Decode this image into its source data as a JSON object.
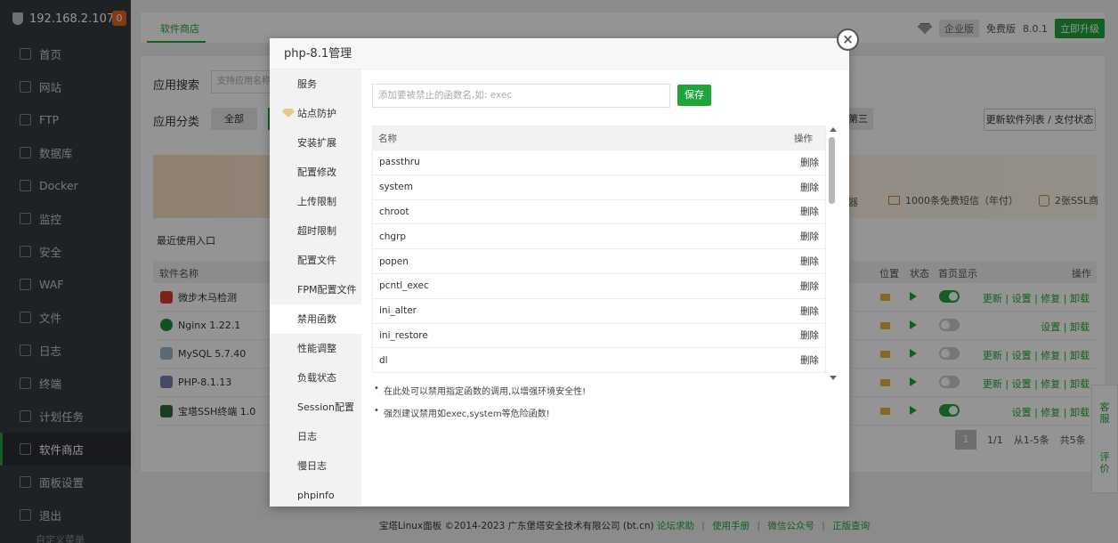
{
  "sidebar": {
    "host": "192.168.2.107",
    "badge": "0",
    "items": [
      {
        "label": "首页"
      },
      {
        "label": "网站"
      },
      {
        "label": "FTP"
      },
      {
        "label": "数据库"
      },
      {
        "label": "Docker"
      },
      {
        "label": "监控"
      },
      {
        "label": "安全"
      },
      {
        "label": "WAF"
      },
      {
        "label": "文件"
      },
      {
        "label": "日志"
      },
      {
        "label": "终端"
      },
      {
        "label": "计划任务"
      },
      {
        "label": "软件商店"
      },
      {
        "label": "面板设置"
      },
      {
        "label": "退出"
      }
    ],
    "tail": "自定义菜单"
  },
  "topbar": {
    "tab": "软件商店",
    "edition": "企业版",
    "free": "免费版",
    "version": "8.0.1",
    "upgrade": "立即升级"
  },
  "store": {
    "search_label": "应用搜索",
    "search_placeholder": "支持应用名称",
    "cat_label": "应用分类",
    "cat_all": "全部",
    "cat_partial": "第三",
    "update_btn": "更新软件列表 / 支付状态",
    "banner_left": "器",
    "banner_sms": "1000条免费短信（年付）",
    "banner_ssl": "2张SSL商",
    "recent": "最近使用入口",
    "th_name": "软件名称",
    "th_loc": "位置",
    "th_status": "状态",
    "th_home": "首页显示",
    "th_ops": "操作",
    "rows": [
      {
        "name": "微步木马检测",
        "ops": "更新 | 设置 | 修复 | 卸载"
      },
      {
        "name": "Nginx 1.22.1",
        "ops": "设置 | 卸载"
      },
      {
        "name": "MySQL 5.7.40",
        "ops": "更新 | 设置 | 修复 | 卸载"
      },
      {
        "name": "PHP-8.1.13",
        "ops": "更新 | 设置 | 修复 | 卸载"
      },
      {
        "name": "宝塔SSH终端 1.0",
        "ops": "设置 | 修复 | 卸载"
      }
    ],
    "pager_cur": "1",
    "pager_pages": "1/1",
    "pager_range": "从1-5条",
    "pager_total": "共5条"
  },
  "footer": {
    "copy": "宝塔Linux面板 ©2014-2023 广东堡塔安全技术有限公司 (bt.cn)",
    "links": [
      "论坛求助",
      "使用手册",
      "微信公众号",
      "正版查询"
    ]
  },
  "float": {
    "service": "客服",
    "review": "评价"
  },
  "modal": {
    "title": "php-8.1管理",
    "nav": [
      "服务",
      "站点防护",
      "安装扩展",
      "配置修改",
      "上传限制",
      "超时限制",
      "配置文件",
      "FPM配置文件",
      "禁用函数",
      "性能调整",
      "负载状态",
      "Session配置",
      "日志",
      "慢日志",
      "phpinfo"
    ],
    "input_placeholder": "添加要被禁止的函数名,如: exec",
    "save": "保存",
    "col_name": "名称",
    "col_op": "操作",
    "delete": "删除",
    "functions": [
      "passthru",
      "system",
      "chroot",
      "chgrp",
      "popen",
      "pcntl_exec",
      "ini_alter",
      "ini_restore",
      "dl"
    ],
    "tips": [
      "在此处可以禁用指定函数的调用,以增强环境安全性!",
      "强烈建议禁用如exec,system等危险函数!"
    ]
  }
}
